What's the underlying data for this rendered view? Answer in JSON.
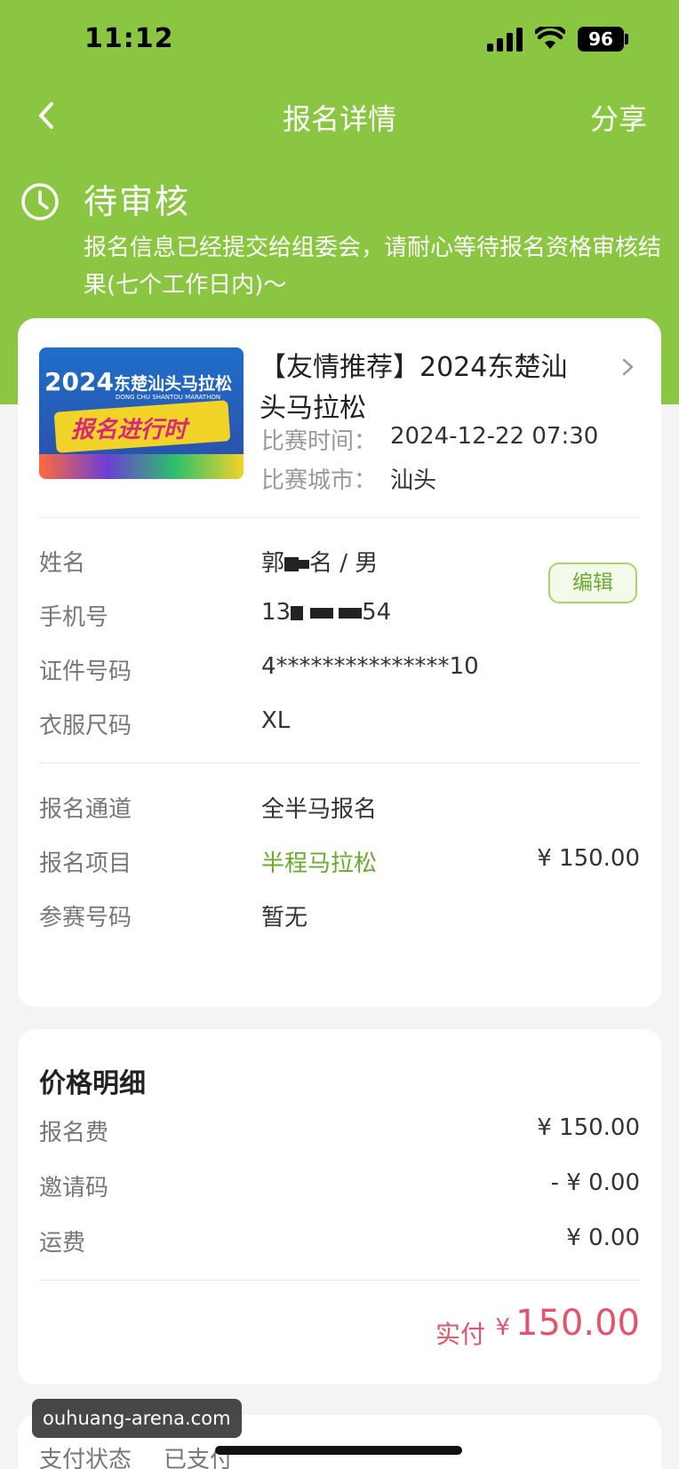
{
  "status_bar": {
    "time": "11:12",
    "battery": "96"
  },
  "nav": {
    "title": "报名详情",
    "share": "分享"
  },
  "status": {
    "title": "待审核",
    "description": "报名信息已经提交给组委会，请耐心等待报名资格审核结果(七个工作日内)～"
  },
  "race": {
    "title": "【友情推荐】2024东楚汕头马拉松",
    "thumb_year": "2024",
    "thumb_name": "东楚汕头马拉松",
    "thumb_en": "DONG CHU SHANTOU MARATHON",
    "thumb_slogan": "报名进行时",
    "time_label": "比赛时间：",
    "time_value": "2024-12-22 07:30",
    "city_label": "比赛城市：",
    "city_value": "汕头"
  },
  "registrant": {
    "name_label": "姓名",
    "name_prefix": "郭",
    "name_suffix": "名 / 男",
    "edit_label": "编辑",
    "phone_label": "手机号",
    "phone_prefix": "13",
    "phone_suffix": "54",
    "id_label": "证件号码",
    "id_value": "4***************10",
    "size_label": "衣服尺码",
    "size_value": "XL"
  },
  "registration": {
    "channel_label": "报名通道",
    "channel_value": "全半马报名",
    "item_label": "报名项目",
    "item_value": "半程马拉松",
    "item_price": "¥ 150.00",
    "bib_label": "参赛号码",
    "bib_value": "暂无"
  },
  "price": {
    "heading": "价格明细",
    "fee_label": "报名费",
    "fee_value": "¥ 150.00",
    "invite_label": "邀请码",
    "invite_value": "- ¥ 0.00",
    "shipping_label": "运费",
    "shipping_value": "¥ 0.00",
    "paid_label": "实付",
    "paid_currency": "¥",
    "paid_value": "150.00"
  },
  "payment": {
    "status_label": "支付状态",
    "status_value": "已支付"
  },
  "watermark": "ouhuang-arena.com",
  "colors": {
    "brand_green": "#8ac641",
    "accent_red": "#e0556b",
    "item_green": "#6aaa33"
  }
}
